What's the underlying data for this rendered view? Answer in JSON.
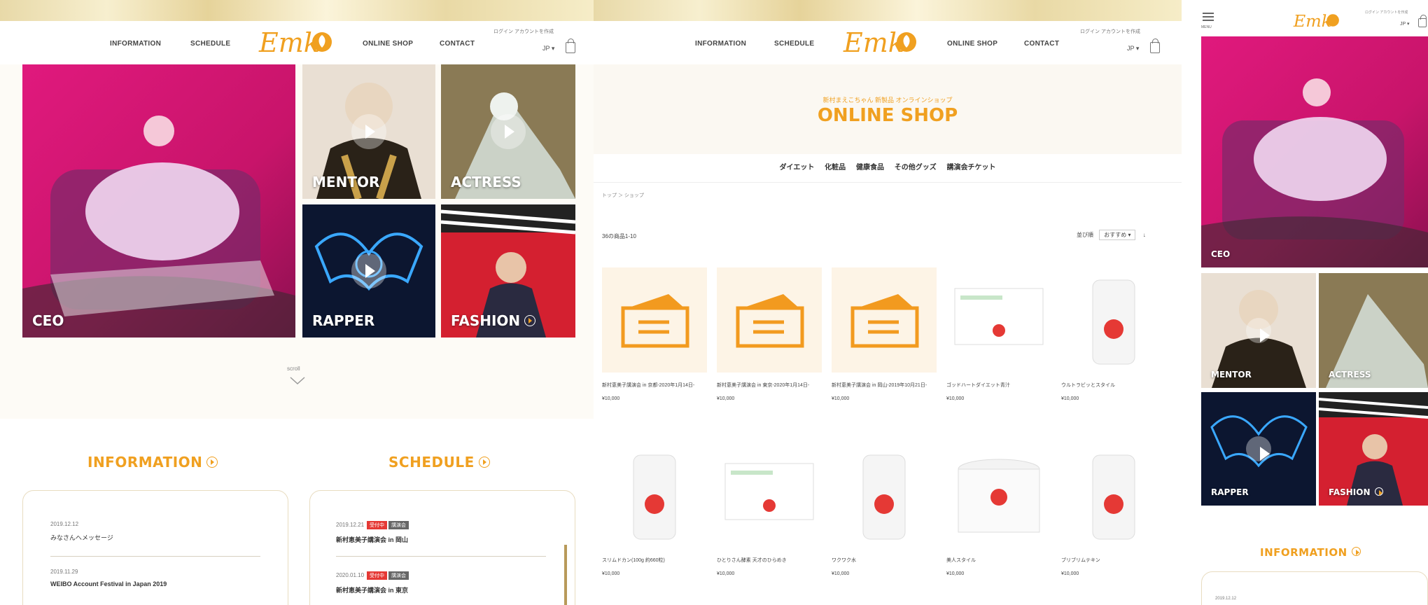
{
  "colors": {
    "accent": "#f0a020",
    "ceo_bg": "#d91a7e",
    "badge_red": "#e53935",
    "badge_gray": "#666666"
  },
  "nav": {
    "information": "INFORMATION",
    "schedule": "SCHEDULE",
    "online_shop": "ONLINE SHOP",
    "contact": "CONTACT"
  },
  "util_links": "ログイン アカウントを作成",
  "lang": "JP ▾",
  "hero": [
    {
      "label": "CEO"
    },
    {
      "label": "MENTOR"
    },
    {
      "label": "ACTRESS"
    },
    {
      "label": "RAPPER"
    },
    {
      "label": "FASHION"
    }
  ],
  "scroll_label": "scroll",
  "information": {
    "title": "INFORMATION",
    "items": [
      {
        "date": "2019.12.12",
        "text": "みなさんへメッセージ"
      },
      {
        "date": "2019.11.29",
        "text": "WEIBO Account Festival in Japan 2019"
      }
    ]
  },
  "schedule": {
    "title": "SCHEDULE",
    "items": [
      {
        "date": "2019.12.21",
        "badges": [
          "受付中",
          "講演会"
        ],
        "text": "新村恵美子講演会 in 岡山"
      },
      {
        "date": "2020.01.10",
        "badges": [
          "受付中",
          "講演会"
        ],
        "text": "新村恵美子講演会 in 東京"
      }
    ]
  },
  "shop": {
    "subtitle": "新村まえこちゃん 新製品 オンラインショップ",
    "title": "ONLINE SHOP",
    "categories": [
      "ダイエット",
      "化粧品",
      "健康食品",
      "その他グッズ",
      "講演会チケット"
    ],
    "breadcrumb": "トップ ＞ ショップ",
    "count_label": "36の商品1-10",
    "sort_label": "並び順",
    "sort_value": "おすすめ ▾",
    "products": [
      {
        "name": "新村恵美子講演会 in 京都-2020年1月14日-",
        "price": "¥10,000",
        "kind": "ticket"
      },
      {
        "name": "新村恵美子講演会 in 東京-2020年1月14日-",
        "price": "¥10,000",
        "kind": "ticket"
      },
      {
        "name": "新村恵美子講演会 in 岡山-2019年10月21日-",
        "price": "¥10,000",
        "kind": "ticket"
      },
      {
        "name": "ゴッドハートダイエット青汁",
        "price": "¥10,000",
        "kind": "box"
      },
      {
        "name": "ウルトラビッとスタイル",
        "price": "¥10,000",
        "kind": "bottle"
      },
      {
        "name": "スリムドカン(100g 約660粒)",
        "price": "¥10,000",
        "kind": "bottle"
      },
      {
        "name": "ひとりさん酵素 天才のひらめき",
        "price": "¥10,000",
        "kind": "box"
      },
      {
        "name": "ワクワク水",
        "price": "¥10,000",
        "kind": "bottle"
      },
      {
        "name": "美人スタイル",
        "price": "¥10,000",
        "kind": "jar"
      },
      {
        "name": "ブリブリムテキン",
        "price": "¥10,000",
        "kind": "bottle"
      }
    ]
  },
  "mobile": {
    "menu_label": "MENU",
    "info_title": "INFORMATION",
    "info_date": "2019.12.12"
  }
}
